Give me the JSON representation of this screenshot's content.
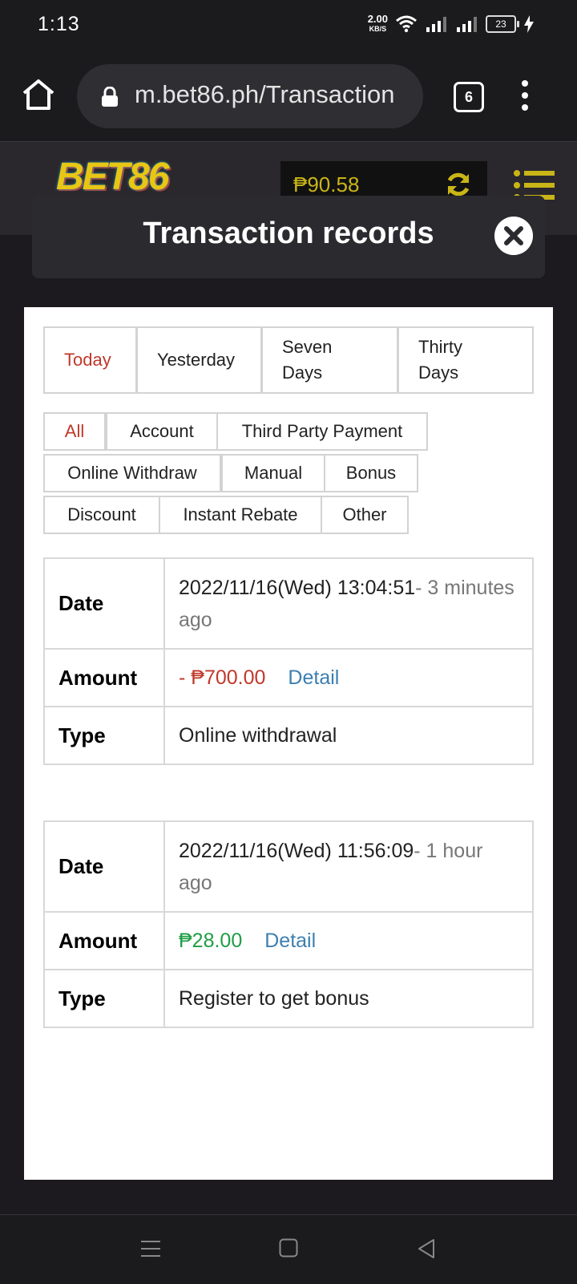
{
  "status_bar": {
    "time": "1:13",
    "net_speed": "2.00",
    "net_unit": "KB/S",
    "battery": "23"
  },
  "browser": {
    "url": "m.bet86.ph/Transaction",
    "tab_count": "6"
  },
  "site": {
    "logo": "BET86",
    "balance": "₱90.58"
  },
  "modal": {
    "title": "Transaction records"
  },
  "date_filters": [
    {
      "label": "Today",
      "active": true
    },
    {
      "label": "Yesterday",
      "active": false
    },
    {
      "label": "Seven Days",
      "active": false
    },
    {
      "label": "Thirty Days",
      "active": false
    }
  ],
  "type_filters": [
    {
      "label": "All",
      "active": true
    },
    {
      "label": "Account",
      "active": false
    },
    {
      "label": "Third Party Payment",
      "active": false
    },
    {
      "label": "Online Withdraw",
      "active": false
    },
    {
      "label": "Manual",
      "active": false
    },
    {
      "label": "Bonus",
      "active": false
    },
    {
      "label": "Discount",
      "active": false
    },
    {
      "label": "Instant Rebate",
      "active": false
    },
    {
      "label": "Other",
      "active": false
    }
  ],
  "labels": {
    "date": "Date",
    "amount": "Amount",
    "type": "Type",
    "detail": "Detail"
  },
  "records": [
    {
      "date": "2022/11/16(Wed) 13:04:51",
      "ago": "- 3 minutes ago",
      "amount": "- ₱700.00",
      "sign": "negative",
      "type": "Online withdrawal"
    },
    {
      "date": "2022/11/16(Wed) 11:56:09",
      "ago": "- 1 hour ago",
      "amount": "₱28.00",
      "sign": "positive",
      "type": "Register to get bonus"
    }
  ],
  "colors": {
    "active": "#c0392b",
    "negative": "#c0392b",
    "positive": "#1e9e45",
    "link": "#3c7fb1",
    "brand_yellow": "#e8c614"
  }
}
